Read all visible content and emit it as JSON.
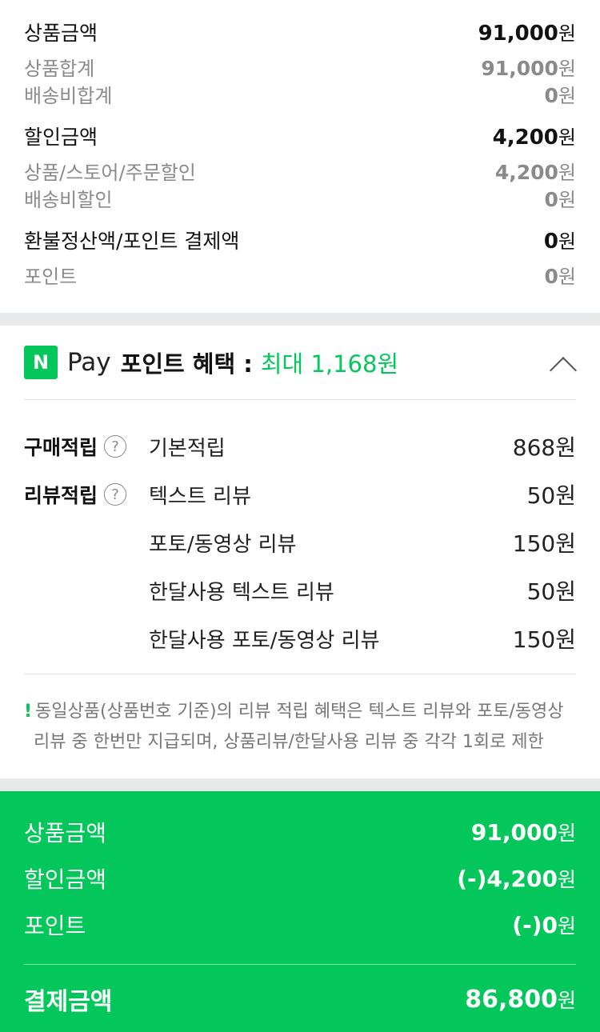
{
  "summary": {
    "product": {
      "label": "상품금액",
      "value": "91,000",
      "unit": "원"
    },
    "product_total": {
      "label": "상품합계",
      "value": "91,000",
      "unit": "원"
    },
    "shipping_total": {
      "label": "배송비합계",
      "value": "0",
      "unit": "원"
    },
    "discount": {
      "label": "할인금액",
      "value": "4,200",
      "unit": "원"
    },
    "store_discount": {
      "label": "상품/스토어/주문할인",
      "value": "4,200",
      "unit": "원"
    },
    "shipping_discount": {
      "label": "배송비할인",
      "value": "0",
      "unit": "원"
    },
    "refund": {
      "label": "환불정산액/포인트 결제액",
      "value": "0",
      "unit": "원"
    },
    "point": {
      "label": "포인트",
      "value": "0",
      "unit": "원"
    }
  },
  "npay": {
    "logo": "N",
    "pay": "Pay",
    "benefit": "포인트 혜택 :",
    "max": "최대 1,168원",
    "rows": [
      {
        "cat": "구매적립",
        "name": "기본적립",
        "value": "868원"
      },
      {
        "cat": "리뷰적립",
        "name": "텍스트 리뷰",
        "value": "50원"
      },
      {
        "cat": "",
        "name": "포토/동영상 리뷰",
        "value": "150원"
      },
      {
        "cat": "",
        "name": "한달사용 텍스트 리뷰",
        "value": "50원"
      },
      {
        "cat": "",
        "name": "한달사용 포토/동영상 리뷰",
        "value": "150원"
      }
    ],
    "notice_bang": "!",
    "notice_l1": "동일상품(상품번호 기준)의 리뷰 적립 혜택은 텍스트 리뷰와 포토/동영상",
    "notice_l2": "리뷰 중 한번만 지급되며, 상품리뷰/한달사용 리뷰 중 각각 1회로 제한"
  },
  "final": {
    "product": {
      "label": "상품금액",
      "value": "91,000",
      "unit": "원"
    },
    "discount": {
      "label": "할인금액",
      "value": "(-)4,200",
      "unit": "원"
    },
    "point": {
      "label": "포인트",
      "value": "(-)0",
      "unit": "원"
    },
    "total": {
      "label": "결제금액",
      "value": "86,800",
      "unit": "원"
    }
  },
  "colors": {
    "brand_green": "#03c75a",
    "separator": "#e8e9eb"
  }
}
